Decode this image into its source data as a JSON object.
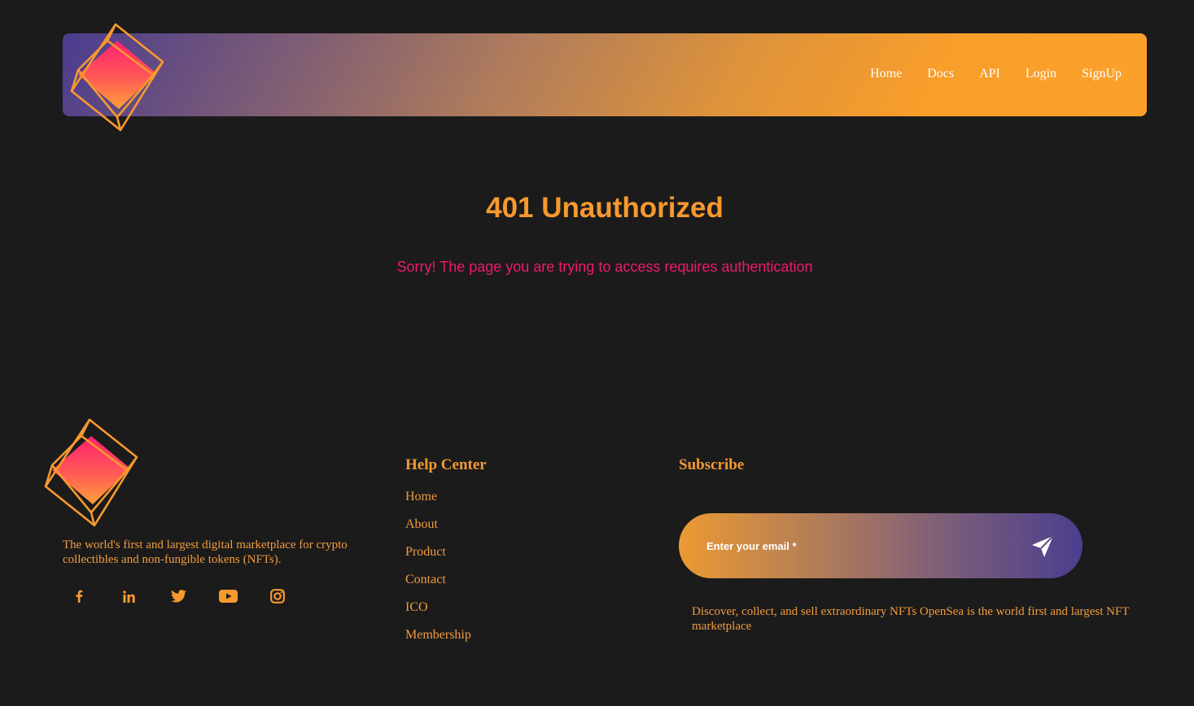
{
  "header": {
    "nav": [
      "Home",
      "Docs",
      "API",
      "Login",
      "SignUp"
    ]
  },
  "error": {
    "title": "401 Unauthorized",
    "message": "Sorry! The page you are trying to access requires authentication"
  },
  "footer": {
    "about": "The world's first and largest digital marketplace for crypto collectibles and non-fungible tokens (NFTs).",
    "socials": [
      "facebook-icon",
      "linkedin-icon",
      "twitter-icon",
      "youtube-icon",
      "instagram-icon"
    ],
    "help_center": {
      "title": "Help Center",
      "links": [
        "Home",
        "About",
        "Product",
        "Contact",
        "ICO",
        "Membership"
      ]
    },
    "subscribe": {
      "title": "Subscribe",
      "placeholder": "Enter your email *",
      "note": "Discover, collect, and sell extraordinary NFTs OpenSea is the world first and largest NFT marketplace"
    }
  },
  "colors": {
    "background": "#1b1b1b",
    "accent_orange": "#f7992e",
    "accent_pink": "#f0196c",
    "accent_purple": "#4b3c8f"
  }
}
